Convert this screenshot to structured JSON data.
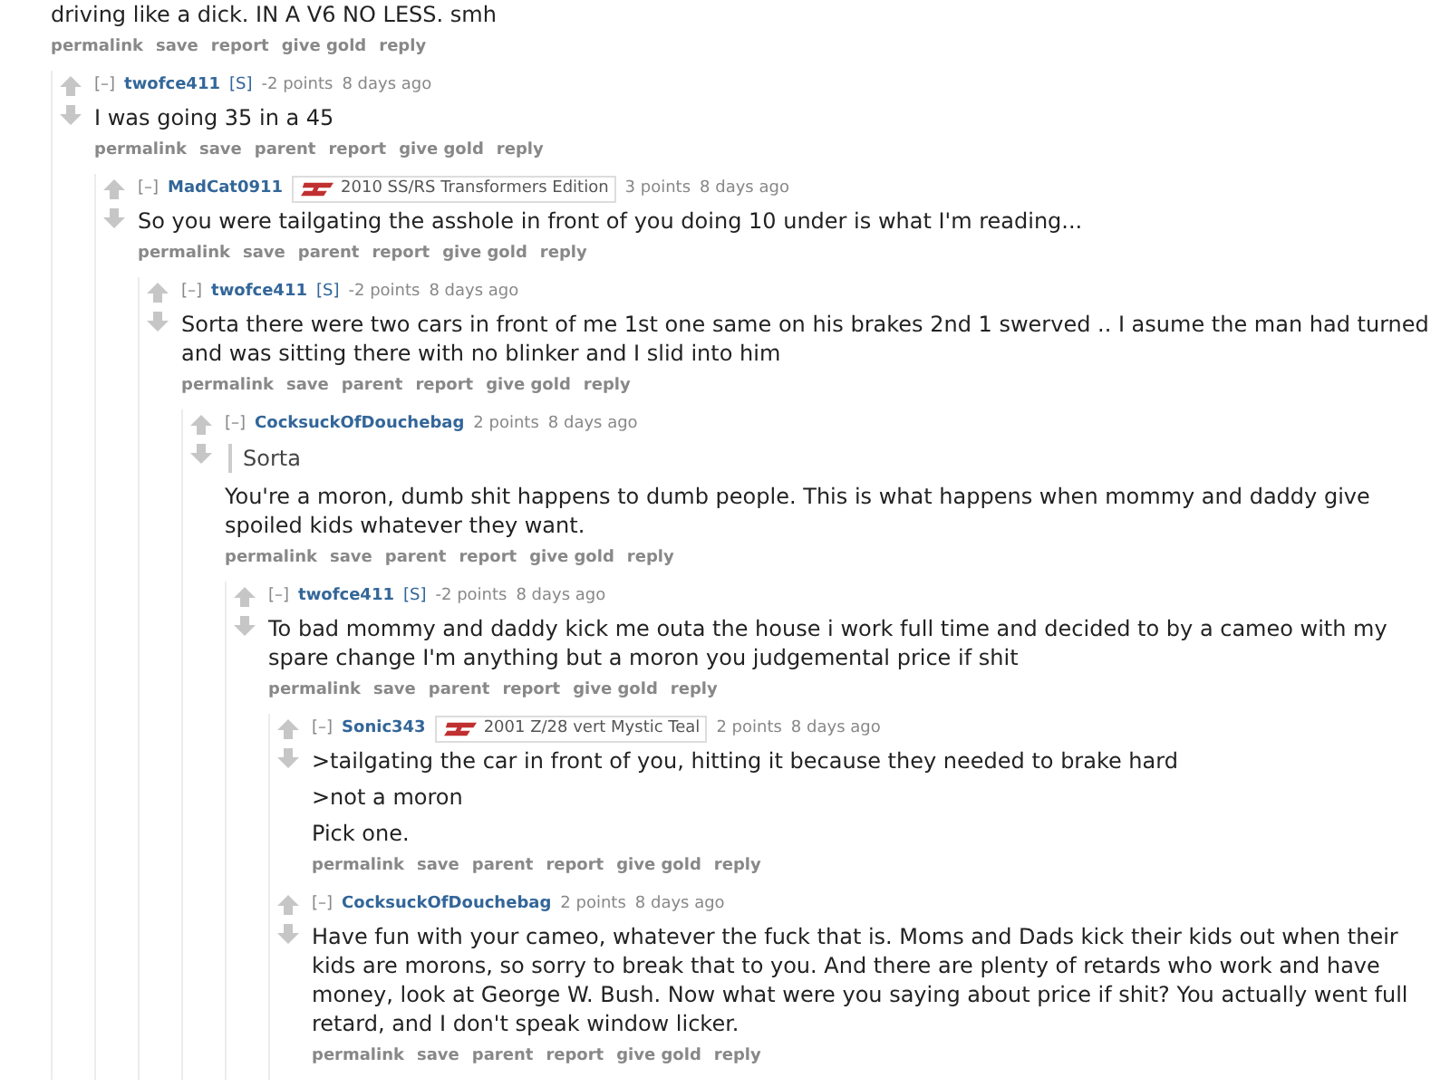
{
  "thread": {
    "paragraphs": [
      "driving like a dick. IN A V6 NO LESS. smh"
    ],
    "actions": [
      "permalink",
      "save",
      "report",
      "give gold",
      "reply"
    ],
    "children": [
      {
        "collapse": "[–]",
        "author": "twofce411",
        "submitter_tag": "[S]",
        "score": "-2 points",
        "time": "8 days ago",
        "paragraphs": [
          "I was going 35 in a 45"
        ],
        "actions": [
          "permalink",
          "save",
          "parent",
          "report",
          "give gold",
          "reply"
        ],
        "children": [
          {
            "collapse": "[–]",
            "author": "MadCat0911",
            "flair": "2010 SS/RS Transformers Edition",
            "score": "3 points",
            "time": "8 days ago",
            "paragraphs": [
              "So you were tailgating the asshole in front of you doing 10 under is what I'm reading..."
            ],
            "actions": [
              "permalink",
              "save",
              "parent",
              "report",
              "give gold",
              "reply"
            ],
            "children": [
              {
                "collapse": "[–]",
                "author": "twofce411",
                "submitter_tag": "[S]",
                "score": "-2 points",
                "time": "8 days ago",
                "paragraphs": [
                  "Sorta there were two cars in front of me 1st one same on his brakes 2nd 1 swerved .. I asume the man had turned and was sitting there with no blinker and I slid into him"
                ],
                "actions": [
                  "permalink",
                  "save",
                  "parent",
                  "report",
                  "give gold",
                  "reply"
                ],
                "children": [
                  {
                    "collapse": "[–]",
                    "author": "CocksuckOfDouchebag",
                    "score": "2 points",
                    "time": "8 days ago",
                    "quote": "Sorta",
                    "paragraphs": [
                      "You're a moron, dumb shit happens to dumb people. This is what happens when mommy and daddy give spoiled kids whatever they want."
                    ],
                    "actions": [
                      "permalink",
                      "save",
                      "parent",
                      "report",
                      "give gold",
                      "reply"
                    ],
                    "children": [
                      {
                        "collapse": "[–]",
                        "author": "twofce411",
                        "submitter_tag": "[S]",
                        "score": "-2 points",
                        "time": "8 days ago",
                        "paragraphs": [
                          "To bad mommy and daddy kick me outa the house i work full time and decided to by a cameo with my spare change I'm anything but a moron you judgemental price if shit"
                        ],
                        "actions": [
                          "permalink",
                          "save",
                          "parent",
                          "report",
                          "give gold",
                          "reply"
                        ],
                        "children": [
                          {
                            "collapse": "[–]",
                            "author": "Sonic343",
                            "flair": "2001 Z/28 vert Mystic Teal",
                            "score": "2 points",
                            "time": "8 days ago",
                            "paragraphs": [
                              ">tailgating the car in front of you, hitting it because they needed to brake hard",
                              ">not a moron",
                              "Pick one."
                            ],
                            "actions": [
                              "permalink",
                              "save",
                              "parent",
                              "report",
                              "give gold",
                              "reply"
                            ]
                          },
                          {
                            "collapse": "[–]",
                            "author": "CocksuckOfDouchebag",
                            "score": "2 points",
                            "time": "8 days ago",
                            "paragraphs": [
                              "Have fun with your cameo, whatever the fuck that is. Moms and Dads kick their kids out when their kids are morons, so sorry to break that to you. And there are plenty of retards who work and have money, look at George W. Bush. Now what were you saying about price if shit? You actually went full retard, and I don't speak window licker."
                            ],
                            "actions": [
                              "permalink",
                              "save",
                              "parent",
                              "report",
                              "give gold",
                              "reply"
                            ]
                          }
                        ]
                      }
                    ]
                  }
                ]
              }
            ]
          }
        ]
      }
    ]
  }
}
